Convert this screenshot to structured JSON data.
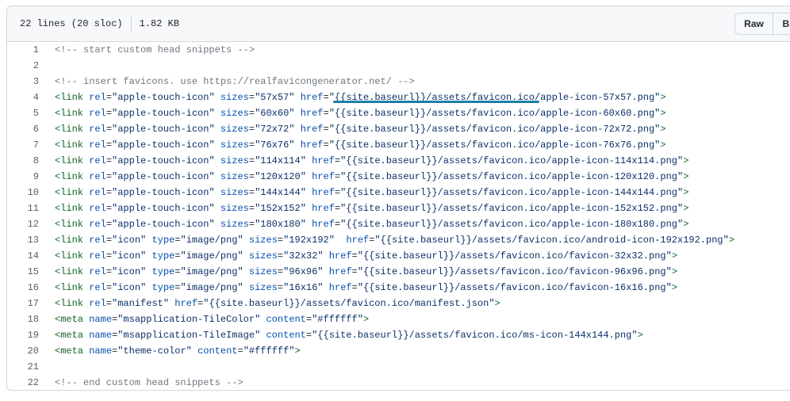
{
  "header": {
    "lines_info": "22 lines (20 sloc)",
    "size": "1.82 KB",
    "raw_label": "Raw",
    "blame_label": "Blame"
  },
  "lines": [
    {
      "n": "1",
      "tokens": [
        {
          "c": "c",
          "t": "<!-- start custom head snippets -->"
        }
      ]
    },
    {
      "n": "2",
      "tokens": []
    },
    {
      "n": "3",
      "tokens": [
        {
          "c": "c",
          "t": "<!-- insert favicons. use https://realfavicongenerator.net/ -->"
        }
      ]
    },
    {
      "n": "4",
      "tokens": [
        {
          "c": "t",
          "t": "<link"
        },
        {
          "c": "p",
          "t": " "
        },
        {
          "c": "a",
          "t": "rel"
        },
        {
          "c": "p",
          "t": "="
        },
        {
          "c": "s",
          "t": "\"apple-touch-icon\""
        },
        {
          "c": "p",
          "t": " "
        },
        {
          "c": "a",
          "t": "sizes"
        },
        {
          "c": "p",
          "t": "="
        },
        {
          "c": "s",
          "t": "\"57x57\""
        },
        {
          "c": "p",
          "t": " "
        },
        {
          "c": "a",
          "t": "href"
        },
        {
          "c": "p",
          "t": "="
        },
        {
          "c": "s",
          "t": "\"{{site.baseurl}}/assets/favicon.ico/apple-icon-57x57.png\""
        },
        {
          "c": "t",
          "t": ">"
        }
      ]
    },
    {
      "n": "5",
      "tokens": [
        {
          "c": "t",
          "t": "<link"
        },
        {
          "c": "p",
          "t": " "
        },
        {
          "c": "a",
          "t": "rel"
        },
        {
          "c": "p",
          "t": "="
        },
        {
          "c": "s",
          "t": "\"apple-touch-icon\""
        },
        {
          "c": "p",
          "t": " "
        },
        {
          "c": "a",
          "t": "sizes"
        },
        {
          "c": "p",
          "t": "="
        },
        {
          "c": "s",
          "t": "\"60x60\""
        },
        {
          "c": "p",
          "t": " "
        },
        {
          "c": "a",
          "t": "href"
        },
        {
          "c": "p",
          "t": "="
        },
        {
          "c": "s",
          "t": "\"{{site.baseurl}}/assets/favicon.ico/apple-icon-60x60.png\""
        },
        {
          "c": "t",
          "t": ">"
        }
      ]
    },
    {
      "n": "6",
      "tokens": [
        {
          "c": "t",
          "t": "<link"
        },
        {
          "c": "p",
          "t": " "
        },
        {
          "c": "a",
          "t": "rel"
        },
        {
          "c": "p",
          "t": "="
        },
        {
          "c": "s",
          "t": "\"apple-touch-icon\""
        },
        {
          "c": "p",
          "t": " "
        },
        {
          "c": "a",
          "t": "sizes"
        },
        {
          "c": "p",
          "t": "="
        },
        {
          "c": "s",
          "t": "\"72x72\""
        },
        {
          "c": "p",
          "t": " "
        },
        {
          "c": "a",
          "t": "href"
        },
        {
          "c": "p",
          "t": "="
        },
        {
          "c": "s",
          "t": "\"{{site.baseurl}}/assets/favicon.ico/apple-icon-72x72.png\""
        },
        {
          "c": "t",
          "t": ">"
        }
      ]
    },
    {
      "n": "7",
      "tokens": [
        {
          "c": "t",
          "t": "<link"
        },
        {
          "c": "p",
          "t": " "
        },
        {
          "c": "a",
          "t": "rel"
        },
        {
          "c": "p",
          "t": "="
        },
        {
          "c": "s",
          "t": "\"apple-touch-icon\""
        },
        {
          "c": "p",
          "t": " "
        },
        {
          "c": "a",
          "t": "sizes"
        },
        {
          "c": "p",
          "t": "="
        },
        {
          "c": "s",
          "t": "\"76x76\""
        },
        {
          "c": "p",
          "t": " "
        },
        {
          "c": "a",
          "t": "href"
        },
        {
          "c": "p",
          "t": "="
        },
        {
          "c": "s",
          "t": "\"{{site.baseurl}}/assets/favicon.ico/apple-icon-76x76.png\""
        },
        {
          "c": "t",
          "t": ">"
        }
      ]
    },
    {
      "n": "8",
      "tokens": [
        {
          "c": "t",
          "t": "<link"
        },
        {
          "c": "p",
          "t": " "
        },
        {
          "c": "a",
          "t": "rel"
        },
        {
          "c": "p",
          "t": "="
        },
        {
          "c": "s",
          "t": "\"apple-touch-icon\""
        },
        {
          "c": "p",
          "t": " "
        },
        {
          "c": "a",
          "t": "sizes"
        },
        {
          "c": "p",
          "t": "="
        },
        {
          "c": "s",
          "t": "\"114x114\""
        },
        {
          "c": "p",
          "t": " "
        },
        {
          "c": "a",
          "t": "href"
        },
        {
          "c": "p",
          "t": "="
        },
        {
          "c": "s",
          "t": "\"{{site.baseurl}}/assets/favicon.ico/apple-icon-114x114.png\""
        },
        {
          "c": "t",
          "t": ">"
        }
      ]
    },
    {
      "n": "9",
      "tokens": [
        {
          "c": "t",
          "t": "<link"
        },
        {
          "c": "p",
          "t": " "
        },
        {
          "c": "a",
          "t": "rel"
        },
        {
          "c": "p",
          "t": "="
        },
        {
          "c": "s",
          "t": "\"apple-touch-icon\""
        },
        {
          "c": "p",
          "t": " "
        },
        {
          "c": "a",
          "t": "sizes"
        },
        {
          "c": "p",
          "t": "="
        },
        {
          "c": "s",
          "t": "\"120x120\""
        },
        {
          "c": "p",
          "t": " "
        },
        {
          "c": "a",
          "t": "href"
        },
        {
          "c": "p",
          "t": "="
        },
        {
          "c": "s",
          "t": "\"{{site.baseurl}}/assets/favicon.ico/apple-icon-120x120.png\""
        },
        {
          "c": "t",
          "t": ">"
        }
      ]
    },
    {
      "n": "10",
      "tokens": [
        {
          "c": "t",
          "t": "<link"
        },
        {
          "c": "p",
          "t": " "
        },
        {
          "c": "a",
          "t": "rel"
        },
        {
          "c": "p",
          "t": "="
        },
        {
          "c": "s",
          "t": "\"apple-touch-icon\""
        },
        {
          "c": "p",
          "t": " "
        },
        {
          "c": "a",
          "t": "sizes"
        },
        {
          "c": "p",
          "t": "="
        },
        {
          "c": "s",
          "t": "\"144x144\""
        },
        {
          "c": "p",
          "t": " "
        },
        {
          "c": "a",
          "t": "href"
        },
        {
          "c": "p",
          "t": "="
        },
        {
          "c": "s",
          "t": "\"{{site.baseurl}}/assets/favicon.ico/apple-icon-144x144.png\""
        },
        {
          "c": "t",
          "t": ">"
        }
      ]
    },
    {
      "n": "11",
      "tokens": [
        {
          "c": "t",
          "t": "<link"
        },
        {
          "c": "p",
          "t": " "
        },
        {
          "c": "a",
          "t": "rel"
        },
        {
          "c": "p",
          "t": "="
        },
        {
          "c": "s",
          "t": "\"apple-touch-icon\""
        },
        {
          "c": "p",
          "t": " "
        },
        {
          "c": "a",
          "t": "sizes"
        },
        {
          "c": "p",
          "t": "="
        },
        {
          "c": "s",
          "t": "\"152x152\""
        },
        {
          "c": "p",
          "t": " "
        },
        {
          "c": "a",
          "t": "href"
        },
        {
          "c": "p",
          "t": "="
        },
        {
          "c": "s",
          "t": "\"{{site.baseurl}}/assets/favicon.ico/apple-icon-152x152.png\""
        },
        {
          "c": "t",
          "t": ">"
        }
      ]
    },
    {
      "n": "12",
      "tokens": [
        {
          "c": "t",
          "t": "<link"
        },
        {
          "c": "p",
          "t": " "
        },
        {
          "c": "a",
          "t": "rel"
        },
        {
          "c": "p",
          "t": "="
        },
        {
          "c": "s",
          "t": "\"apple-touch-icon\""
        },
        {
          "c": "p",
          "t": " "
        },
        {
          "c": "a",
          "t": "sizes"
        },
        {
          "c": "p",
          "t": "="
        },
        {
          "c": "s",
          "t": "\"180x180\""
        },
        {
          "c": "p",
          "t": " "
        },
        {
          "c": "a",
          "t": "href"
        },
        {
          "c": "p",
          "t": "="
        },
        {
          "c": "s",
          "t": "\"{{site.baseurl}}/assets/favicon.ico/apple-icon-180x180.png\""
        },
        {
          "c": "t",
          "t": ">"
        }
      ]
    },
    {
      "n": "13",
      "tokens": [
        {
          "c": "t",
          "t": "<link"
        },
        {
          "c": "p",
          "t": " "
        },
        {
          "c": "a",
          "t": "rel"
        },
        {
          "c": "p",
          "t": "="
        },
        {
          "c": "s",
          "t": "\"icon\""
        },
        {
          "c": "p",
          "t": " "
        },
        {
          "c": "a",
          "t": "type"
        },
        {
          "c": "p",
          "t": "="
        },
        {
          "c": "s",
          "t": "\"image/png\""
        },
        {
          "c": "p",
          "t": " "
        },
        {
          "c": "a",
          "t": "sizes"
        },
        {
          "c": "p",
          "t": "="
        },
        {
          "c": "s",
          "t": "\"192x192\""
        },
        {
          "c": "p",
          "t": "  "
        },
        {
          "c": "a",
          "t": "href"
        },
        {
          "c": "p",
          "t": "="
        },
        {
          "c": "s",
          "t": "\"{{site.baseurl}}/assets/favicon.ico/android-icon-192x192.png\""
        },
        {
          "c": "t",
          "t": ">"
        }
      ]
    },
    {
      "n": "14",
      "tokens": [
        {
          "c": "t",
          "t": "<link"
        },
        {
          "c": "p",
          "t": " "
        },
        {
          "c": "a",
          "t": "rel"
        },
        {
          "c": "p",
          "t": "="
        },
        {
          "c": "s",
          "t": "\"icon\""
        },
        {
          "c": "p",
          "t": " "
        },
        {
          "c": "a",
          "t": "type"
        },
        {
          "c": "p",
          "t": "="
        },
        {
          "c": "s",
          "t": "\"image/png\""
        },
        {
          "c": "p",
          "t": " "
        },
        {
          "c": "a",
          "t": "sizes"
        },
        {
          "c": "p",
          "t": "="
        },
        {
          "c": "s",
          "t": "\"32x32\""
        },
        {
          "c": "p",
          "t": " "
        },
        {
          "c": "a",
          "t": "href"
        },
        {
          "c": "p",
          "t": "="
        },
        {
          "c": "s",
          "t": "\"{{site.baseurl}}/assets/favicon.ico/favicon-32x32.png\""
        },
        {
          "c": "t",
          "t": ">"
        }
      ]
    },
    {
      "n": "15",
      "tokens": [
        {
          "c": "t",
          "t": "<link"
        },
        {
          "c": "p",
          "t": " "
        },
        {
          "c": "a",
          "t": "rel"
        },
        {
          "c": "p",
          "t": "="
        },
        {
          "c": "s",
          "t": "\"icon\""
        },
        {
          "c": "p",
          "t": " "
        },
        {
          "c": "a",
          "t": "type"
        },
        {
          "c": "p",
          "t": "="
        },
        {
          "c": "s",
          "t": "\"image/png\""
        },
        {
          "c": "p",
          "t": " "
        },
        {
          "c": "a",
          "t": "sizes"
        },
        {
          "c": "p",
          "t": "="
        },
        {
          "c": "s",
          "t": "\"96x96\""
        },
        {
          "c": "p",
          "t": " "
        },
        {
          "c": "a",
          "t": "href"
        },
        {
          "c": "p",
          "t": "="
        },
        {
          "c": "s",
          "t": "\"{{site.baseurl}}/assets/favicon.ico/favicon-96x96.png\""
        },
        {
          "c": "t",
          "t": ">"
        }
      ]
    },
    {
      "n": "16",
      "tokens": [
        {
          "c": "t",
          "t": "<link"
        },
        {
          "c": "p",
          "t": " "
        },
        {
          "c": "a",
          "t": "rel"
        },
        {
          "c": "p",
          "t": "="
        },
        {
          "c": "s",
          "t": "\"icon\""
        },
        {
          "c": "p",
          "t": " "
        },
        {
          "c": "a",
          "t": "type"
        },
        {
          "c": "p",
          "t": "="
        },
        {
          "c": "s",
          "t": "\"image/png\""
        },
        {
          "c": "p",
          "t": " "
        },
        {
          "c": "a",
          "t": "sizes"
        },
        {
          "c": "p",
          "t": "="
        },
        {
          "c": "s",
          "t": "\"16x16\""
        },
        {
          "c": "p",
          "t": " "
        },
        {
          "c": "a",
          "t": "href"
        },
        {
          "c": "p",
          "t": "="
        },
        {
          "c": "s",
          "t": "\"{{site.baseurl}}/assets/favicon.ico/favicon-16x16.png\""
        },
        {
          "c": "t",
          "t": ">"
        }
      ]
    },
    {
      "n": "17",
      "tokens": [
        {
          "c": "t",
          "t": "<link"
        },
        {
          "c": "p",
          "t": " "
        },
        {
          "c": "a",
          "t": "rel"
        },
        {
          "c": "p",
          "t": "="
        },
        {
          "c": "s",
          "t": "\"manifest\""
        },
        {
          "c": "p",
          "t": " "
        },
        {
          "c": "a",
          "t": "href"
        },
        {
          "c": "p",
          "t": "="
        },
        {
          "c": "s",
          "t": "\"{{site.baseurl}}/assets/favicon.ico/manifest.json\""
        },
        {
          "c": "t",
          "t": ">"
        }
      ]
    },
    {
      "n": "18",
      "tokens": [
        {
          "c": "t",
          "t": "<meta"
        },
        {
          "c": "p",
          "t": " "
        },
        {
          "c": "a",
          "t": "name"
        },
        {
          "c": "p",
          "t": "="
        },
        {
          "c": "s",
          "t": "\"msapplication-TileColor\""
        },
        {
          "c": "p",
          "t": " "
        },
        {
          "c": "a",
          "t": "content"
        },
        {
          "c": "p",
          "t": "="
        },
        {
          "c": "s",
          "t": "\"#ffffff\""
        },
        {
          "c": "t",
          "t": ">"
        }
      ]
    },
    {
      "n": "19",
      "tokens": [
        {
          "c": "t",
          "t": "<meta"
        },
        {
          "c": "p",
          "t": " "
        },
        {
          "c": "a",
          "t": "name"
        },
        {
          "c": "p",
          "t": "="
        },
        {
          "c": "s",
          "t": "\"msapplication-TileImage\""
        },
        {
          "c": "p",
          "t": " "
        },
        {
          "c": "a",
          "t": "content"
        },
        {
          "c": "p",
          "t": "="
        },
        {
          "c": "s",
          "t": "\"{{site.baseurl}}/assets/favicon.ico/ms-icon-144x144.png\""
        },
        {
          "c": "t",
          "t": ">"
        }
      ]
    },
    {
      "n": "20",
      "tokens": [
        {
          "c": "t",
          "t": "<meta"
        },
        {
          "c": "p",
          "t": " "
        },
        {
          "c": "a",
          "t": "name"
        },
        {
          "c": "p",
          "t": "="
        },
        {
          "c": "s",
          "t": "\"theme-color\""
        },
        {
          "c": "p",
          "t": " "
        },
        {
          "c": "a",
          "t": "content"
        },
        {
          "c": "p",
          "t": "="
        },
        {
          "c": "s",
          "t": "\"#ffffff\""
        },
        {
          "c": "t",
          "t": ">"
        }
      ]
    },
    {
      "n": "21",
      "tokens": []
    },
    {
      "n": "22",
      "tokens": [
        {
          "c": "c",
          "t": "<!-- end custom head snippets -->"
        }
      ]
    }
  ],
  "colors": {
    "comment": "#6e7781",
    "tag": "#116329",
    "attr": "#0550ae",
    "string": "#0a3069",
    "highlight_underline": "#1c7fa6"
  }
}
